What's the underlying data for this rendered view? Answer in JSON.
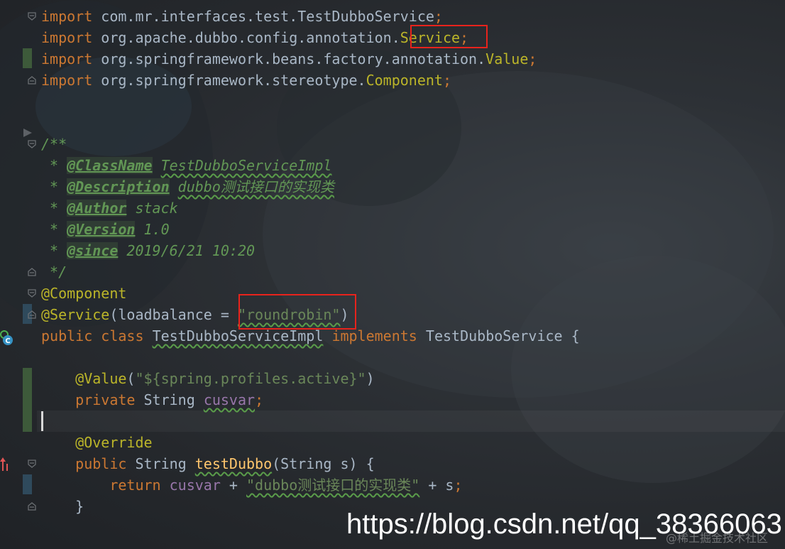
{
  "editor": {
    "imports": [
      {
        "kw": "import",
        "path": "com.mr.interfaces.test.TestDubboService",
        "end": ";"
      },
      {
        "kw": "import",
        "path": "org.apache.dubbo.config.annotation.",
        "cls": "Service",
        "end": ";"
      },
      {
        "kw": "import",
        "path": "org.springframework.beans.factory.annotation.",
        "cls": "Value",
        "end": ";"
      },
      {
        "kw": "import",
        "path": "org.springframework.stereotype.",
        "cls": "Component",
        "end": ";"
      }
    ],
    "javadoc": {
      "open": "/**",
      "star": " * ",
      "close": " */",
      "tags": [
        {
          "tag": "@ClassName",
          "value": "TestDubboServiceImpl"
        },
        {
          "tag": "@Description",
          "value": "dubbo测试接口的实现类"
        },
        {
          "tag": "@Author",
          "value": "stack"
        },
        {
          "tag": "@Version",
          "value": "1.0"
        },
        {
          "tag": "@since",
          "value": "2019/6/21 10:20"
        }
      ]
    },
    "annotations": {
      "component": "@Component",
      "service": "@Service",
      "service_args_open": "(loadbalance = ",
      "service_value": "\"roundrobin\"",
      "service_args_close": ")"
    },
    "class_decl": {
      "public": "public",
      "class": "class",
      "name": "TestDubboServiceImpl",
      "implements": "implements",
      "iface": "TestDubboService",
      "brace": " {"
    },
    "field": {
      "annotation": "@Value",
      "arg": "\"${spring.profiles.active}\"",
      "private": "private",
      "type": "String",
      "name": "cusvar",
      "end": ";"
    },
    "method": {
      "annotation": "@Override",
      "public": "public",
      "type": "String",
      "name": "testDubbo",
      "params": "(String s) {",
      "return_kw": "return",
      "return_var": "cusvar",
      "plus": " + ",
      "return_str": "\"dubbo测试接口的实现类\"",
      "tail": " + s",
      "end": ";",
      "close": "}"
    },
    "colors": {
      "keyword": "#cc7832",
      "string": "#6a8759",
      "annotation": "#bbb529",
      "comment": "#629755",
      "text": "#a9b7c6",
      "highlight_box": "#e8231c"
    }
  },
  "watermark": {
    "url": "https://blog.csdn.net/qq_38366063",
    "secondary": "@稀土掘金技术社区"
  },
  "icons": [
    "fold-icon",
    "implements-class-icon",
    "override-arrow-icon",
    "breakpoint-marker-icon"
  ]
}
